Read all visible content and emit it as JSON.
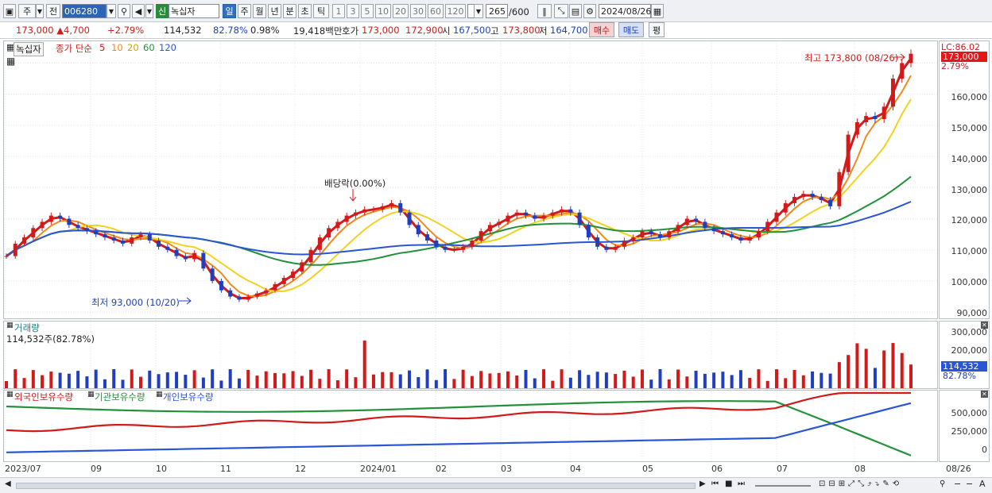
{
  "toolbar": {
    "market": "주",
    "prev": "전",
    "code": "006280",
    "badge": "신",
    "name": "녹십자",
    "periods": [
      "일",
      "주",
      "월",
      "년",
      "분",
      "초",
      "틱"
    ],
    "active_period": "일",
    "intervals": [
      "1",
      "3",
      "5",
      "10",
      "20",
      "30",
      "60",
      "120"
    ],
    "count": "265",
    "count_max": "/600",
    "date": "2024/08/26"
  },
  "quote": {
    "price": "173,000",
    "change": "4,700",
    "change_pct": "+2.79%",
    "volume": "114,532",
    "vol_ratio": "82.78%",
    "turnover": "0.98%",
    "amount": "19,418백만",
    "bid_label": "호가",
    "bid": "173,000",
    "ask": "172,900",
    "open_label": "시",
    "open": "167,500",
    "high_label": "고",
    "high": "173,800",
    "low_label": "저",
    "low": "164,700",
    "buy": "매수",
    "sell": "매도",
    "eval": "평"
  },
  "price_panel": {
    "stock": "녹십자",
    "legend_prefix": "종가 단순",
    "ma": [
      {
        "period": "5",
        "color": "#d21a1a"
      },
      {
        "period": "10",
        "color": "#ef8a1c"
      },
      {
        "period": "20",
        "color": "#f2d21e"
      },
      {
        "period": "60",
        "color": "#22913a"
      },
      {
        "period": "120",
        "color": "#2a55d6"
      }
    ],
    "lc": "LC:86.02",
    "last": "173,000",
    "last_pct": "2.79%",
    "max_note": "최고 173,800 (08/26)",
    "min_note": "최저 93,000 (10/20)",
    "dividend": "배당락(0.00%)",
    "y_ticks": [
      "160,000",
      "150,000",
      "140,000",
      "130,000",
      "120,000",
      "110,000",
      "100,000",
      "90,000"
    ]
  },
  "volume_panel": {
    "title": "거래량",
    "value": "114,532주(82.78%)",
    "y_ticks": [
      "300,000",
      "200,000",
      "100,000"
    ],
    "last": "114,532",
    "last_pct": "82.78%"
  },
  "holding_panel": {
    "s1": "외국인보유수량",
    "s2": "기관보유수량",
    "s3": "개인보유수량",
    "y_ticks": [
      "500,000",
      "250,000",
      "0"
    ]
  },
  "x_axis": [
    "2023/07",
    "09",
    "10",
    "11",
    "12",
    "2024/01",
    "02",
    "03",
    "04",
    "05",
    "06",
    "07",
    "08",
    "08/26"
  ],
  "chart_data": {
    "type": "candlestick",
    "ylim": [
      88000,
      177000
    ],
    "closes": [
      108000,
      112000,
      114000,
      117000,
      119000,
      121000,
      120000,
      118000,
      117000,
      116000,
      115000,
      114000,
      113000,
      112000,
      114000,
      115000,
      113000,
      111000,
      110000,
      108000,
      107000,
      109000,
      104000,
      100000,
      97000,
      95000,
      94000,
      95000,
      96000,
      97000,
      99000,
      101000,
      103000,
      106000,
      110000,
      114000,
      117000,
      119000,
      121000,
      122000,
      123000,
      123000,
      124000,
      125000,
      122000,
      118000,
      115000,
      113000,
      111000,
      110000,
      110000,
      111000,
      113000,
      116000,
      118000,
      119000,
      121000,
      122000,
      121000,
      120000,
      121000,
      122000,
      123000,
      122000,
      118000,
      114000,
      111000,
      110000,
      111000,
      113000,
      114000,
      116000,
      115000,
      114000,
      116000,
      118000,
      120000,
      119000,
      117000,
      116000,
      115000,
      114000,
      113000,
      114000,
      116000,
      119000,
      122000,
      125000,
      127000,
      128000,
      127000,
      126000,
      124000,
      135000,
      147000,
      151000,
      153000,
      152000,
      156000,
      165000,
      170000,
      173000
    ],
    "ma_data": "moving averages of the close series"
  }
}
